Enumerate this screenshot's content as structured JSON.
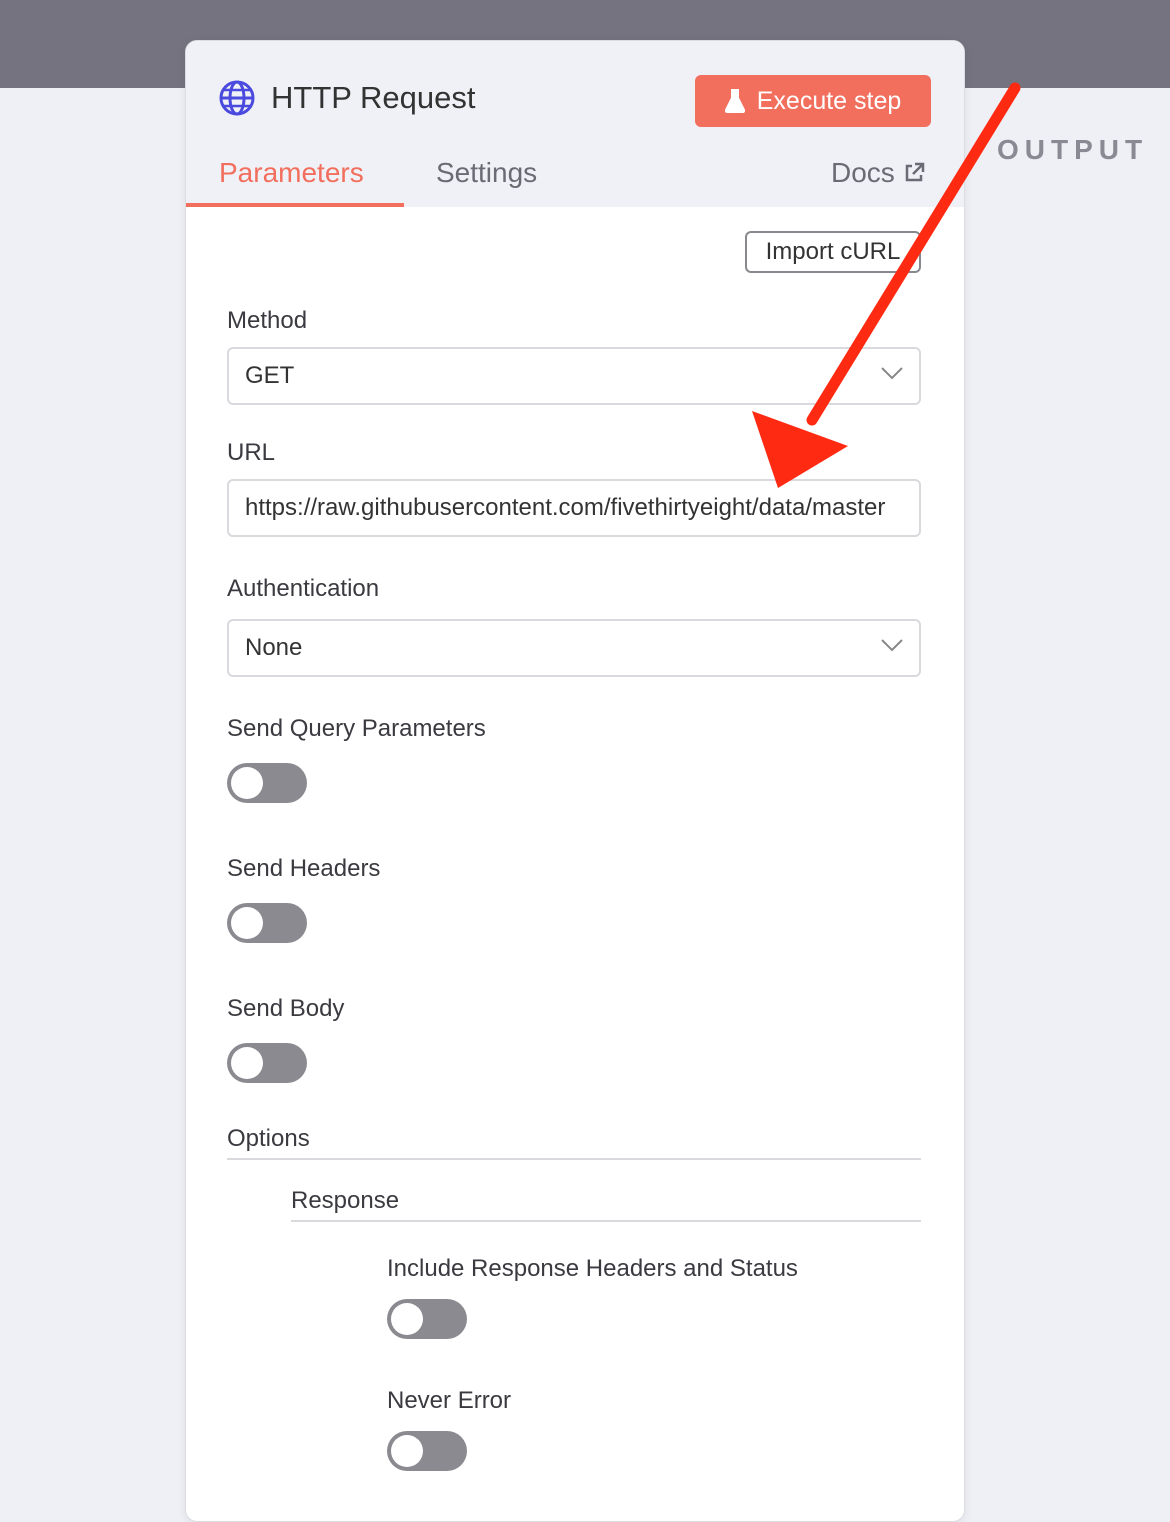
{
  "output_label": "OUTPUT",
  "node": {
    "title": "HTTP Request",
    "execute_label": "Execute step",
    "tabs": {
      "parameters": "Parameters",
      "settings": "Settings",
      "docs": "Docs"
    }
  },
  "import_curl_label": "Import cURL",
  "method": {
    "label": "Method",
    "value": "GET"
  },
  "url": {
    "label": "URL",
    "value": "https://raw.githubusercontent.com/fivethirtyeight/data/master"
  },
  "authentication": {
    "label": "Authentication",
    "value": "None"
  },
  "send_query": {
    "label": "Send Query Parameters",
    "enabled": false
  },
  "send_headers": {
    "label": "Send Headers",
    "enabled": false
  },
  "send_body": {
    "label": "Send Body",
    "enabled": false
  },
  "options": {
    "label": "Options",
    "response": {
      "label": "Response",
      "include_headers": {
        "label": "Include Response Headers and Status",
        "enabled": false
      },
      "never_error": {
        "label": "Never Error",
        "enabled": false
      }
    }
  },
  "colors": {
    "accent": "#f26e5d",
    "annotation_arrow": "#ff2a12",
    "toggle_off": "#8a8a90"
  }
}
